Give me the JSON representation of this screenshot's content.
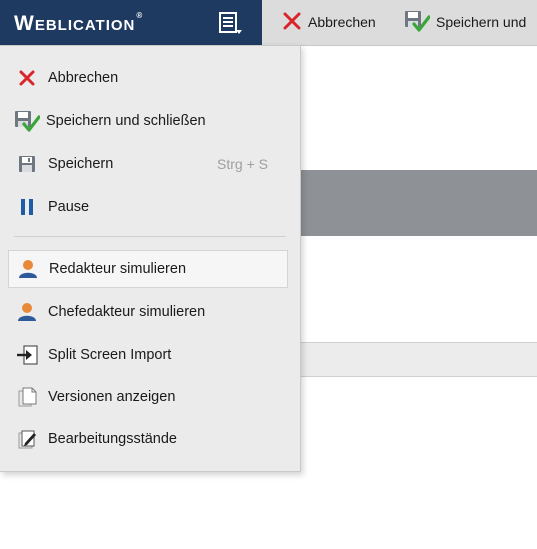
{
  "header": {
    "brand_cap": "W",
    "brand_rest": "EBLICATION",
    "brand_reg": "®"
  },
  "toolbar": {
    "cancel_label": "Abbrechen",
    "save_close_label": "Speichern und"
  },
  "menu": {
    "items": [
      {
        "label": "Abbrechen",
        "icon": "cancel-x-icon"
      },
      {
        "label": "Speichern und schließen",
        "icon": "save-check-icon"
      },
      {
        "label": "Speichern",
        "shortcut": "Strg + S",
        "icon": "floppy-icon"
      },
      {
        "label": "Pause",
        "icon": "pause-icon"
      },
      {
        "label": "Redakteur simulieren",
        "icon": "user-icon"
      },
      {
        "label": "Chefedakteur simulieren",
        "icon": "user-icon"
      },
      {
        "label": "Split Screen Import",
        "icon": "import-icon"
      },
      {
        "label": "Versionen anzeigen",
        "icon": "versions-icon"
      },
      {
        "label": "Bearbeitungsstände",
        "icon": "edit-states-icon"
      }
    ]
  },
  "colors": {
    "brand_bg": "#1f3a60",
    "cancel_red": "#d8242a",
    "check_green": "#3aa63a",
    "pause_blue": "#1e5ba8",
    "user_orange": "#e8893a",
    "user_blue": "#2c5a9a"
  }
}
